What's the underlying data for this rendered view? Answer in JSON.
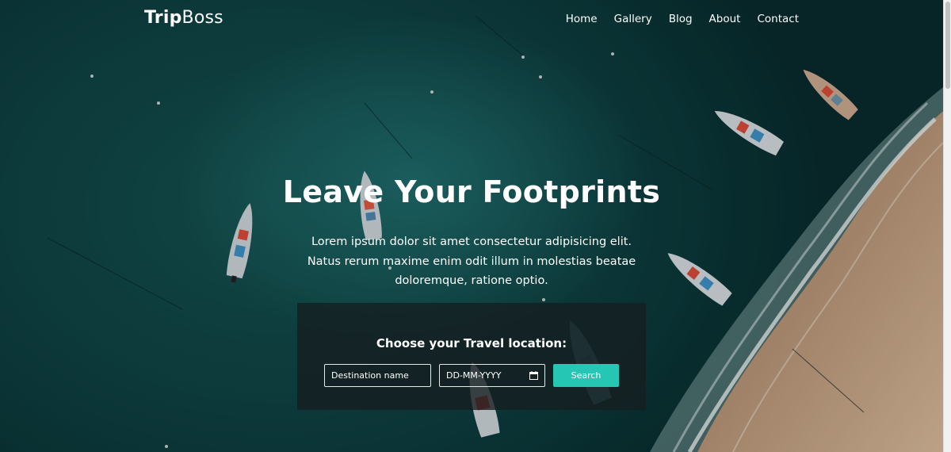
{
  "brand": {
    "bold": "Trip",
    "light": "Boss"
  },
  "nav": [
    "Home",
    "Gallery",
    "Blog",
    "About",
    "Contact"
  ],
  "hero": {
    "headline": "Leave Your Footprints",
    "lead": "Lorem ipsum dolor sit amet consectetur adipisicing elit. Natus rerum maxime enim odit illum in molestias beatae doloremque, ratione optio."
  },
  "search": {
    "title": "Choose your Travel location:",
    "destination_placeholder": "Destination name",
    "date_placeholder": "DD-MM-YYYY",
    "date_icon": "calendar-icon",
    "button_label": "Search"
  },
  "colors": {
    "accent": "#26c6b4",
    "water": "#14514f",
    "sand": "#b89272"
  }
}
